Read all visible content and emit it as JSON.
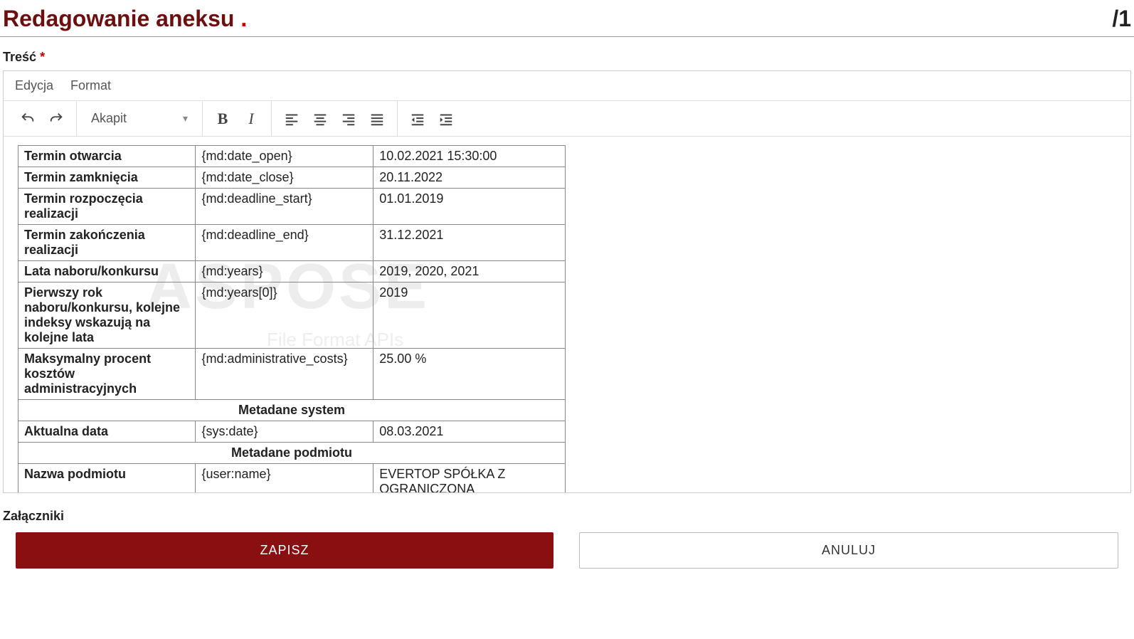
{
  "header": {
    "title": "Redagowanie aneksu",
    "dot": ".",
    "right": "/1"
  },
  "labels": {
    "content": "Treść",
    "attachments": "Załączniki"
  },
  "menu": {
    "edit": "Edycja",
    "format": "Format"
  },
  "toolbar": {
    "block_format": "Akapit"
  },
  "watermark": {
    "main": "ASPOSE",
    "sub": "File Format APIs"
  },
  "table": {
    "rows": [
      {
        "label": "Termin otwarcia",
        "code": "{md:date_open}",
        "value": "10.02.2021 15:30:00"
      },
      {
        "label": "Termin zamknięcia",
        "code": "{md:date_close}",
        "value": "20.11.2022"
      },
      {
        "label": "Termin rozpoczęcia realizacji",
        "code": "{md:deadline_start}",
        "value": "01.01.2019"
      },
      {
        "label": "Termin zakończenia realizacji",
        "code": "{md:deadline_end}",
        "value": "31.12.2021"
      },
      {
        "label": "Lata naboru/konkursu",
        "code": "{md:years}",
        "value": "2019, 2020, 2021"
      },
      {
        "label": "Pierwszy rok naboru/konkursu, kolejne indeksy wskazują na kolejne lata",
        "code": "{md:years[0]}",
        "value": "2019"
      },
      {
        "label": "Maksymalny procent kosztów administracyjnych",
        "code": "{md:administrative_costs}",
        "value": "25.00 %"
      }
    ],
    "section_system": "Metadane system",
    "rows_system": [
      {
        "label": "Aktualna data",
        "code": "{sys:date}",
        "value": "08.03.2021"
      }
    ],
    "section_entity": "Metadane podmiotu",
    "rows_entity": [
      {
        "label": "Nazwa podmiotu",
        "code": "{user:name}",
        "value": "EVERTOP SPÓŁKA Z OGRANICZONĄ ODPOWIEDZIALNOŚCIĄ"
      }
    ]
  },
  "buttons": {
    "save": "ZAPISZ",
    "cancel": "ANULUJ"
  }
}
